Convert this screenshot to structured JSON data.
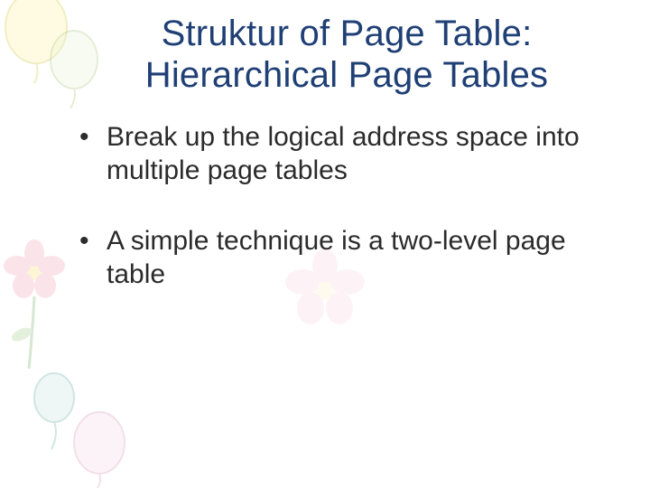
{
  "slide": {
    "title": "Struktur of Page Table: Hierarchical Page Tables",
    "bullets": [
      "Break up the logical address space into multiple page tables",
      "A simple technique is a two-level page table"
    ]
  }
}
